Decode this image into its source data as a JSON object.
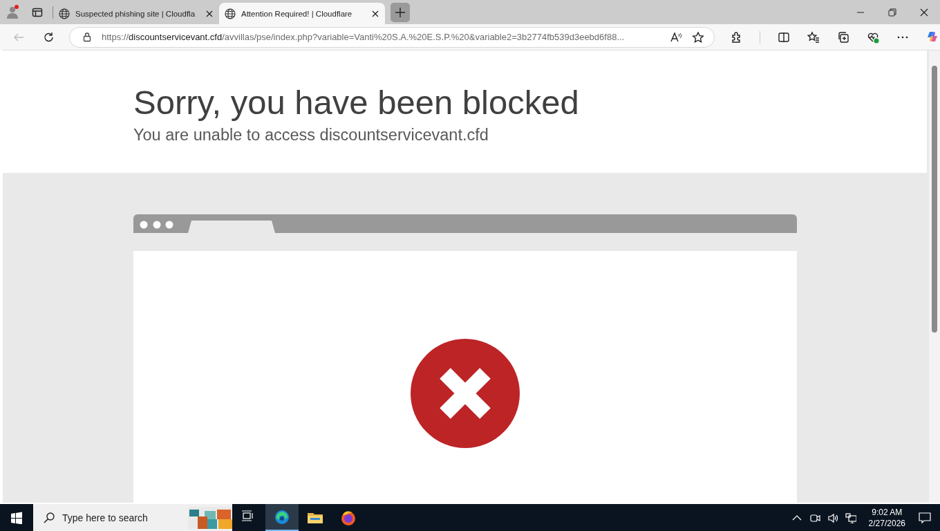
{
  "tabs": [
    {
      "title": "Suspected phishing site | Cloudfla",
      "selected": false
    },
    {
      "title": "Attention Required! | Cloudflare",
      "selected": true
    }
  ],
  "address_bar": {
    "scheme": "https://",
    "host": "discountservicevant.cfd",
    "path": "/avvillas/pse/index.php?variable=Vanti%20S.A.%20E.S.P.%20&variable2=3b2774fb539d3eebd6f88..."
  },
  "page": {
    "heading": "Sorry, you have been blocked",
    "subheading": "You are unable to access discountservicevant.cfd"
  },
  "taskbar": {
    "search_placeholder": "Type here to search",
    "apps": [
      {
        "kind": "task-view",
        "selected": false
      },
      {
        "kind": "edge",
        "selected": true
      },
      {
        "kind": "files",
        "selected": false
      },
      {
        "kind": "firefox",
        "selected": false
      }
    ],
    "time": "9:02 AM",
    "date": "2/27/2026"
  }
}
